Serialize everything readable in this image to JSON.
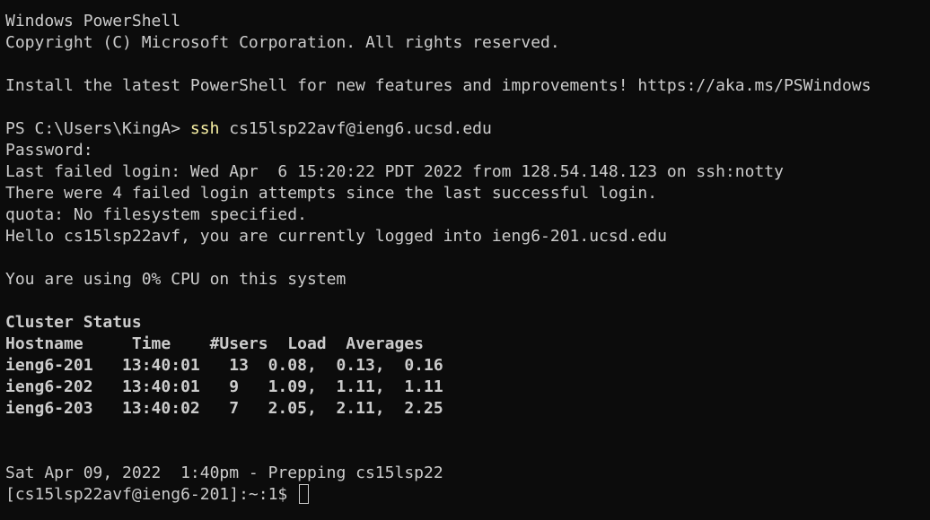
{
  "header": {
    "title": "Windows PowerShell",
    "copyright": "Copyright (C) Microsoft Corporation. All rights reserved.",
    "install_notice": "Install the latest PowerShell for new features and improvements! https://aka.ms/PSWindows"
  },
  "prompt": {
    "ps_prompt": "PS C:\\Users\\KingA> ",
    "command": "ssh",
    "args": " cs15lsp22avf@ieng6.ucsd.edu"
  },
  "session": {
    "password": "Password:",
    "last_failed": "Last failed login: Wed Apr  6 15:20:22 PDT 2022 from 128.54.148.123 on ssh:notty",
    "failed_attempts": "There were 4 failed login attempts since the last successful login.",
    "quota": "quota: No filesystem specified.",
    "hello": "Hello cs15lsp22avf, you are currently logged into ieng6-201.ucsd.edu",
    "cpu": "You are using 0% CPU on this system"
  },
  "cluster": {
    "title": "Cluster Status",
    "header": "Hostname     Time    #Users  Load  Averages",
    "rows": [
      "ieng6-201   13:40:01   13  0.08,  0.13,  0.16",
      "ieng6-202   13:40:01   9   1.09,  1.11,  1.11",
      "ieng6-203   13:40:02   7   2.05,  2.11,  2.25"
    ]
  },
  "footer": {
    "date_line": "Sat Apr 09, 2022  1:40pm - Prepping cs15lsp22",
    "shell_prompt": "[cs15lsp22avf@ieng6-201]:~:1$ "
  }
}
